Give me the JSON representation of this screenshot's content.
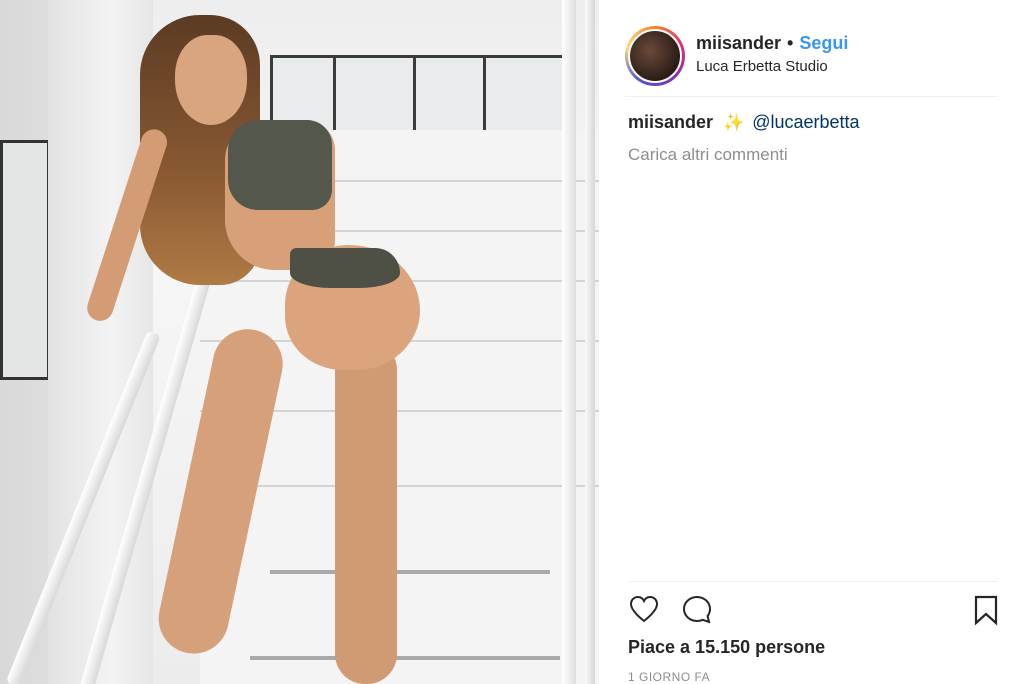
{
  "header": {
    "username": "miisander",
    "separator": "•",
    "follow_label": "Segui",
    "location": "Luca Erbetta Studio"
  },
  "comments": {
    "items": [
      {
        "user": "miisander",
        "emoji": "✨",
        "text": "@lucaerbetta"
      }
    ],
    "load_more_label": "Carica altri commenti"
  },
  "actions": {
    "like_icon": "heart-icon",
    "comment_icon": "comment-bubble-icon",
    "save_icon": "bookmark-icon"
  },
  "likes_text": "Piace a 15.150 persone",
  "timestamp": "1 giorno fa",
  "colors": {
    "follow": "#3897f0",
    "mention": "#003569",
    "muted": "#8e8e8e",
    "text": "#262626"
  }
}
